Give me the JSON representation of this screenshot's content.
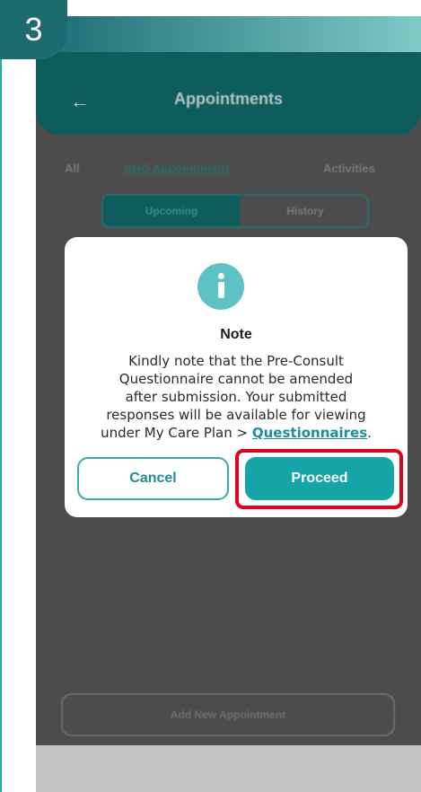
{
  "step": {
    "number": "3"
  },
  "app": {
    "title": "Appointments",
    "tabs": [
      "All",
      "NHG Appointments",
      "Activities"
    ],
    "segments": [
      "Upcoming",
      "History"
    ],
    "add_button": "Add New Appointment"
  },
  "dialog": {
    "title": "Note",
    "message_lines": [
      "Kindly note that the Pre-Consult",
      "Questionnaire cannot be amended",
      "after submission. Your submitted",
      "responses will be available for viewing",
      "under My Care Plan > "
    ],
    "link_text": "Questionnaires",
    "link_suffix": ".",
    "cancel_label": "Cancel",
    "proceed_label": "Proceed"
  },
  "colors": {
    "accent": "#15a5a8",
    "badge": "#1d6a70",
    "highlight": "#e0001b"
  }
}
